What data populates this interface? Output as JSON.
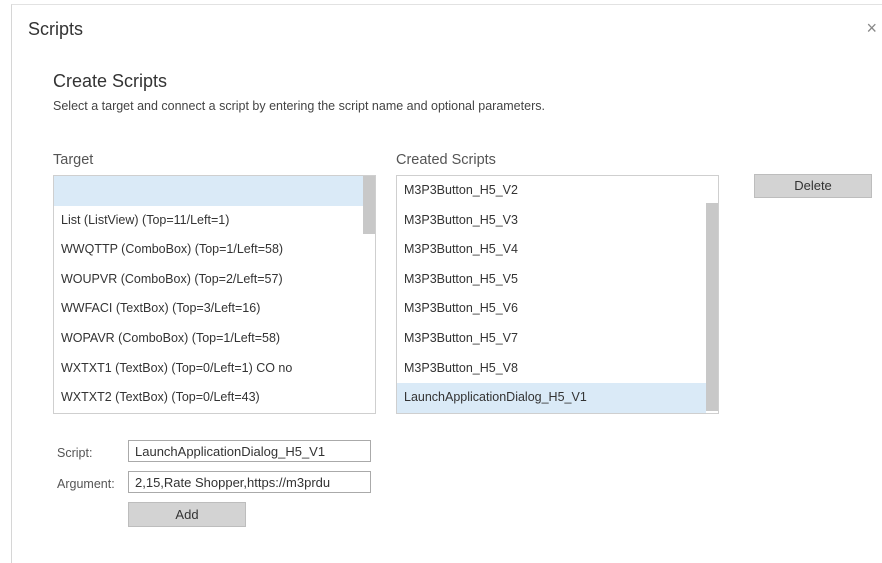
{
  "dialog": {
    "title": "Scripts",
    "close_label": "×",
    "heading": "Create Scripts",
    "description": "Select a target and connect a script by entering the script name and optional parameters."
  },
  "target": {
    "label": "Target",
    "items": [
      {
        "label": "",
        "selected": true
      },
      {
        "label": "List (ListView) (Top=11/Left=1)"
      },
      {
        "label": "WWQTTP (ComboBox) (Top=1/Left=58)"
      },
      {
        "label": "WOUPVR (ComboBox) (Top=2/Left=57)"
      },
      {
        "label": "WWFACI (TextBox) (Top=3/Left=16)"
      },
      {
        "label": "WOPAVR (ComboBox) (Top=1/Left=58)"
      },
      {
        "label": "WXTXT1 (TextBox) (Top=0/Left=1) CO no"
      },
      {
        "label": "WXTXT2 (TextBox) (Top=0/Left=43)"
      }
    ]
  },
  "created": {
    "label": "Created Scripts",
    "items": [
      {
        "label": "M3P3Button_H5_V2"
      },
      {
        "label": "M3P3Button_H5_V3"
      },
      {
        "label": "M3P3Button_H5_V4"
      },
      {
        "label": "M3P3Button_H5_V5"
      },
      {
        "label": "M3P3Button_H5_V6"
      },
      {
        "label": "M3P3Button_H5_V7"
      },
      {
        "label": "M3P3Button_H5_V8"
      },
      {
        "label": "LaunchApplicationDialog_H5_V1",
        "selected": true
      }
    ]
  },
  "buttons": {
    "delete_label": "Delete",
    "add_label": "Add"
  },
  "form": {
    "script_label": "Script:",
    "script_value": "LaunchApplicationDialog_H5_V1",
    "argument_label": "Argument:",
    "argument_value": "2,15,Rate Shopper,https://m3prdu"
  },
  "colors": {
    "selection": "#daeaf7",
    "button": "#d3d3d3",
    "scrollbar": "#c8c8c8"
  }
}
